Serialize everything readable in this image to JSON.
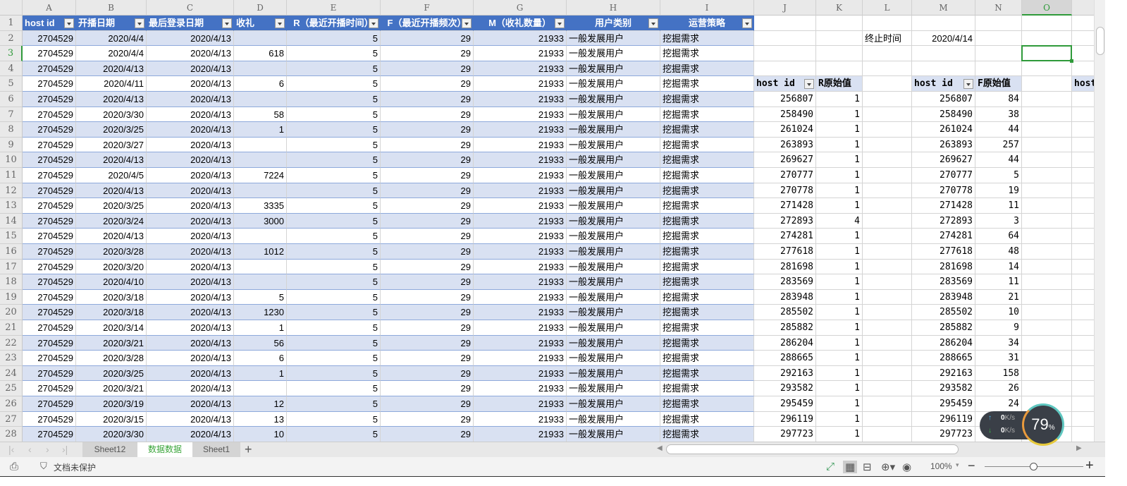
{
  "columns": [
    "A",
    "B",
    "C",
    "D",
    "E",
    "F",
    "G",
    "H",
    "I",
    "J",
    "K",
    "L",
    "M",
    "N",
    "O",
    ""
  ],
  "selected_cell": "O3",
  "main_table": {
    "headers": [
      "host id",
      "开播日期",
      "最后登录日期",
      "收礼",
      "R（最近开播时间）",
      "F（最近开播频次）",
      "M（收礼数量）",
      "用户类别",
      "运营策略"
    ],
    "rows": [
      [
        "2704529",
        "2020/4/4",
        "2020/4/13",
        "",
        "5",
        "29",
        "21933",
        "一般发展用户",
        "挖掘需求"
      ],
      [
        "2704529",
        "2020/4/4",
        "2020/4/13",
        "618",
        "5",
        "29",
        "21933",
        "一般发展用户",
        "挖掘需求"
      ],
      [
        "2704529",
        "2020/4/13",
        "2020/4/13",
        "",
        "5",
        "29",
        "21933",
        "一般发展用户",
        "挖掘需求"
      ],
      [
        "2704529",
        "2020/4/11",
        "2020/4/13",
        "6",
        "5",
        "29",
        "21933",
        "一般发展用户",
        "挖掘需求"
      ],
      [
        "2704529",
        "2020/4/13",
        "2020/4/13",
        "",
        "5",
        "29",
        "21933",
        "一般发展用户",
        "挖掘需求"
      ],
      [
        "2704529",
        "2020/3/30",
        "2020/4/13",
        "58",
        "5",
        "29",
        "21933",
        "一般发展用户",
        "挖掘需求"
      ],
      [
        "2704529",
        "2020/3/25",
        "2020/4/13",
        "1",
        "5",
        "29",
        "21933",
        "一般发展用户",
        "挖掘需求"
      ],
      [
        "2704529",
        "2020/3/27",
        "2020/4/13",
        "",
        "5",
        "29",
        "21933",
        "一般发展用户",
        "挖掘需求"
      ],
      [
        "2704529",
        "2020/4/13",
        "2020/4/13",
        "",
        "5",
        "29",
        "21933",
        "一般发展用户",
        "挖掘需求"
      ],
      [
        "2704529",
        "2020/4/5",
        "2020/4/13",
        "7224",
        "5",
        "29",
        "21933",
        "一般发展用户",
        "挖掘需求"
      ],
      [
        "2704529",
        "2020/4/13",
        "2020/4/13",
        "",
        "5",
        "29",
        "21933",
        "一般发展用户",
        "挖掘需求"
      ],
      [
        "2704529",
        "2020/3/25",
        "2020/4/13",
        "3335",
        "5",
        "29",
        "21933",
        "一般发展用户",
        "挖掘需求"
      ],
      [
        "2704529",
        "2020/3/24",
        "2020/4/13",
        "3000",
        "5",
        "29",
        "21933",
        "一般发展用户",
        "挖掘需求"
      ],
      [
        "2704529",
        "2020/4/13",
        "2020/4/13",
        "",
        "5",
        "29",
        "21933",
        "一般发展用户",
        "挖掘需求"
      ],
      [
        "2704529",
        "2020/3/28",
        "2020/4/13",
        "1012",
        "5",
        "29",
        "21933",
        "一般发展用户",
        "挖掘需求"
      ],
      [
        "2704529",
        "2020/3/20",
        "2020/4/13",
        "",
        "5",
        "29",
        "21933",
        "一般发展用户",
        "挖掘需求"
      ],
      [
        "2704529",
        "2020/4/10",
        "2020/4/13",
        "",
        "5",
        "29",
        "21933",
        "一般发展用户",
        "挖掘需求"
      ],
      [
        "2704529",
        "2020/3/18",
        "2020/4/13",
        "5",
        "5",
        "29",
        "21933",
        "一般发展用户",
        "挖掘需求"
      ],
      [
        "2704529",
        "2020/3/18",
        "2020/4/13",
        "1230",
        "5",
        "29",
        "21933",
        "一般发展用户",
        "挖掘需求"
      ],
      [
        "2704529",
        "2020/3/14",
        "2020/4/13",
        "1",
        "5",
        "29",
        "21933",
        "一般发展用户",
        "挖掘需求"
      ],
      [
        "2704529",
        "2020/3/21",
        "2020/4/13",
        "56",
        "5",
        "29",
        "21933",
        "一般发展用户",
        "挖掘需求"
      ],
      [
        "2704529",
        "2020/3/28",
        "2020/4/13",
        "6",
        "5",
        "29",
        "21933",
        "一般发展用户",
        "挖掘需求"
      ],
      [
        "2704529",
        "2020/3/25",
        "2020/4/13",
        "1",
        "5",
        "29",
        "21933",
        "一般发展用户",
        "挖掘需求"
      ],
      [
        "2704529",
        "2020/3/21",
        "2020/4/13",
        "",
        "5",
        "29",
        "21933",
        "一般发展用户",
        "挖掘需求"
      ],
      [
        "2704529",
        "2020/3/19",
        "2020/4/13",
        "12",
        "5",
        "29",
        "21933",
        "一般发展用户",
        "挖掘需求"
      ],
      [
        "2704529",
        "2020/3/15",
        "2020/4/13",
        "13",
        "5",
        "29",
        "21933",
        "一般发展用户",
        "挖掘需求"
      ],
      [
        "2704529",
        "2020/3/30",
        "2020/4/13",
        "10",
        "5",
        "29",
        "21933",
        "一般发展用户",
        "挖掘需求"
      ]
    ]
  },
  "end_time": {
    "label": "终止时间",
    "value": "2020/4/14"
  },
  "r_table": {
    "headers": [
      "host id",
      "R原始值"
    ],
    "rows": [
      [
        "256807",
        "1"
      ],
      [
        "258490",
        "1"
      ],
      [
        "261024",
        "1"
      ],
      [
        "263893",
        "1"
      ],
      [
        "269627",
        "1"
      ],
      [
        "270777",
        "1"
      ],
      [
        "270778",
        "1"
      ],
      [
        "271428",
        "1"
      ],
      [
        "272893",
        "4"
      ],
      [
        "274281",
        "1"
      ],
      [
        "277618",
        "1"
      ],
      [
        "281698",
        "1"
      ],
      [
        "283569",
        "1"
      ],
      [
        "283948",
        "1"
      ],
      [
        "285502",
        "1"
      ],
      [
        "285882",
        "1"
      ],
      [
        "286204",
        "1"
      ],
      [
        "288665",
        "1"
      ],
      [
        "292163",
        "1"
      ],
      [
        "293582",
        "1"
      ],
      [
        "295459",
        "1"
      ],
      [
        "296119",
        "1"
      ],
      [
        "297723",
        "1"
      ]
    ]
  },
  "f_table": {
    "headers": [
      "host id",
      "F原始值"
    ],
    "rows": [
      [
        "256807",
        "84"
      ],
      [
        "258490",
        "38"
      ],
      [
        "261024",
        "44"
      ],
      [
        "263893",
        "257"
      ],
      [
        "269627",
        "44"
      ],
      [
        "270777",
        "5"
      ],
      [
        "270778",
        "19"
      ],
      [
        "271428",
        "11"
      ],
      [
        "272893",
        "3"
      ],
      [
        "274281",
        "64"
      ],
      [
        "277618",
        "48"
      ],
      [
        "281698",
        "14"
      ],
      [
        "283569",
        "11"
      ],
      [
        "283948",
        "21"
      ],
      [
        "285502",
        "10"
      ],
      [
        "285882",
        "9"
      ],
      [
        "286204",
        "34"
      ],
      [
        "288665",
        "31"
      ],
      [
        "292163",
        "158"
      ],
      [
        "293582",
        "26"
      ],
      [
        "295459",
        "24"
      ],
      [
        "296119",
        ""
      ],
      [
        "297723",
        ""
      ]
    ]
  },
  "third_table_header": "host",
  "sheet_tabs": [
    {
      "label": "Sheet12"
    },
    {
      "label": "数据数据",
      "active": true
    },
    {
      "label": "Sheet1"
    }
  ],
  "add_sheet": "+",
  "status": {
    "protect_label": "文档未保护",
    "zoom": "100%",
    "zoom_level": 0.5
  },
  "net_widget": {
    "upload": "0",
    "download": "0",
    "unit": "K/s",
    "cpu": "79",
    "cpu_unit": "%"
  }
}
